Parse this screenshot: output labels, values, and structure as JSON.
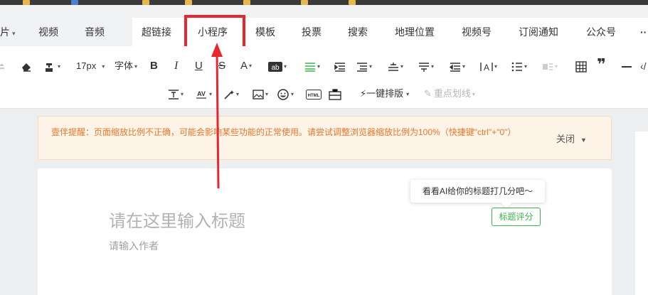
{
  "menubar": {
    "items": [
      "图片",
      "视频",
      "音频"
    ],
    "tabs": [
      "超链接",
      "小程序",
      "模板",
      "投票",
      "搜索",
      "地理位置",
      "视频号",
      "订阅通知",
      "公众号"
    ],
    "more": "··"
  },
  "toolbar": {
    "font_size": "17px",
    "font_family": "字体",
    "one_click_layout": "一键排版",
    "highlight": "重点划线",
    "icons": [
      "undo-icon",
      "eraser-icon",
      "format-painter-icon",
      "bold-icon",
      "italic-icon",
      "underline-icon",
      "strikethrough-icon",
      "font-color-icon",
      "background-color-icon",
      "align-left-icon",
      "align-center-icon",
      "indent-icon",
      "line-height-icon",
      "paragraph-spacing-icon",
      "outdent-icon",
      "letter-spacing-icon",
      "list-icon",
      "numbered-list-icon",
      "table-icon",
      "quote-icon",
      "divider-icon",
      "code-icon",
      "paragraph-height-icon",
      "character-spacing-icon",
      "magic-wand-icon",
      "image-icon",
      "emoji-icon",
      "html-icon",
      "toolbox-icon",
      "lightning-icon",
      "marker-icon"
    ]
  },
  "notice": {
    "text": "壹伴提醒：页面缩放比例不正确，可能会影响某些功能的正常使用。请尝试调整浏览器缩放比例为100%（快捷键\"ctrl\"+\"0\"）",
    "close": "关闭"
  },
  "editor": {
    "title_placeholder": "请在这里输入标题",
    "author_placeholder": "请输入作者",
    "tooltip": "看看AI给你的标题打几分吧～",
    "score_button": "标题评分"
  },
  "colors": {
    "annotation_red": "#e8262d",
    "notice_orange": "#e8782a",
    "accent_green": "#3bb54a"
  }
}
